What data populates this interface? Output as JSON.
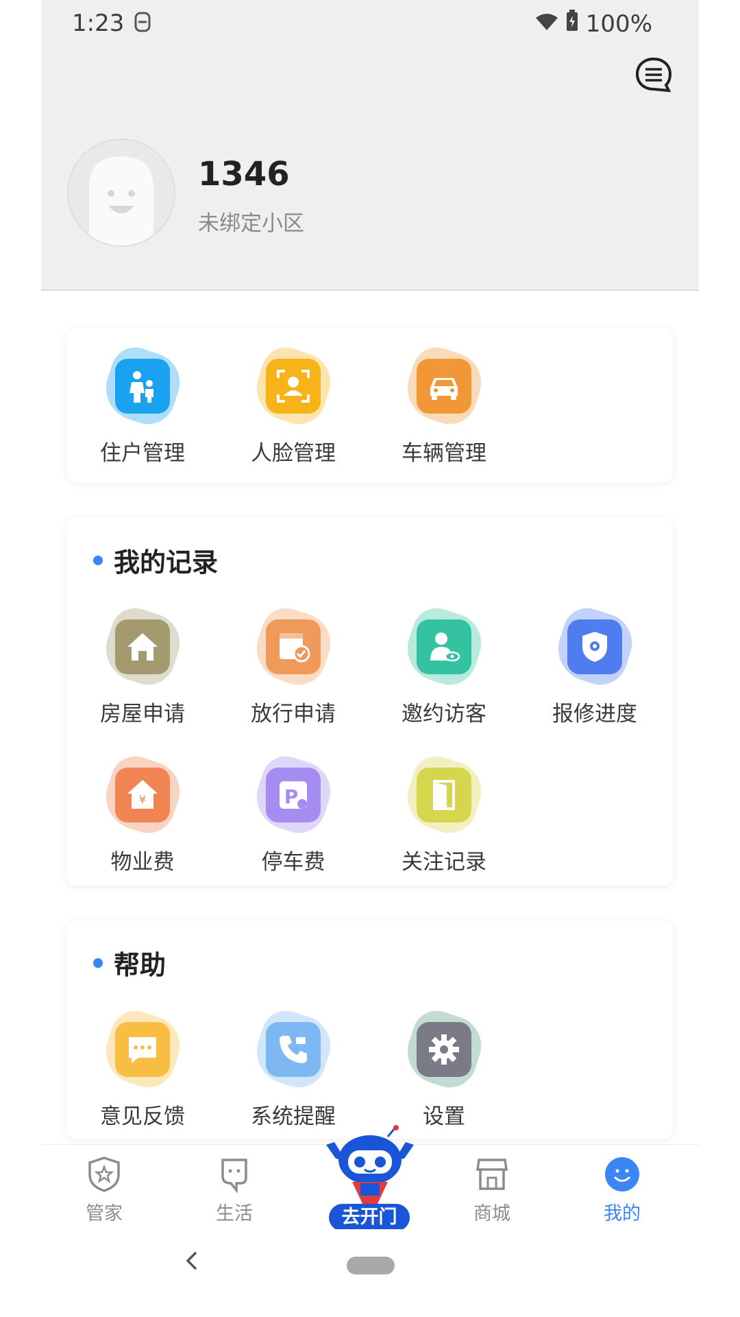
{
  "status_bar": {
    "time": "1:23",
    "battery": "100%"
  },
  "profile": {
    "username": "1346",
    "community": "未绑定小区"
  },
  "quick_manage": {
    "items": [
      {
        "label": "住户管理",
        "icon": "residents-icon",
        "color": "#1aa1f0"
      },
      {
        "label": "人脸管理",
        "icon": "face-scan-icon",
        "color": "#f7b318"
      },
      {
        "label": "车辆管理",
        "icon": "car-icon",
        "color": "#f29737"
      }
    ]
  },
  "records": {
    "title": "我的记录",
    "items": [
      {
        "label": "房屋申请",
        "icon": "house-icon",
        "color": "#a39a6f"
      },
      {
        "label": "放行申请",
        "icon": "pass-approve-icon",
        "color": "#ef9a5a"
      },
      {
        "label": "邀约访客",
        "icon": "visitor-icon",
        "color": "#34c2a0"
      },
      {
        "label": "报修进度",
        "icon": "repair-shield-icon",
        "color": "#4f7df0"
      },
      {
        "label": "物业费",
        "icon": "property-fee-icon",
        "color": "#f18453"
      },
      {
        "label": "停车费",
        "icon": "parking-fee-icon",
        "color": "#a48cf0"
      },
      {
        "label": "关注记录",
        "icon": "door-icon",
        "color": "#d6d54e"
      }
    ]
  },
  "help": {
    "title": "帮助",
    "items": [
      {
        "label": "意见反馈",
        "icon": "feedback-icon",
        "color": "#f8be44"
      },
      {
        "label": "系统提醒",
        "icon": "phone-reminder-icon",
        "color": "#7eb8f3"
      },
      {
        "label": "设置",
        "icon": "settings-gear-icon",
        "color": "#7a7b86"
      }
    ]
  },
  "bottom_nav": {
    "items": [
      {
        "label": "管家",
        "icon": "shield-star-icon"
      },
      {
        "label": "生活",
        "icon": "life-face-icon"
      },
      {
        "label": "去开门",
        "icon": "robot-mascot-icon"
      },
      {
        "label": "商城",
        "icon": "store-icon"
      },
      {
        "label": "我的",
        "icon": "smile-icon",
        "active": true
      }
    ],
    "active_color": "#3a86f5"
  }
}
